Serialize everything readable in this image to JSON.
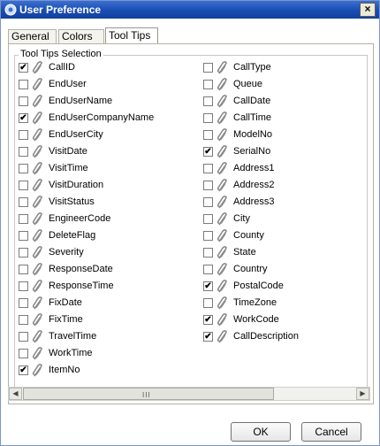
{
  "window": {
    "title": "User Preference",
    "close_glyph": "×"
  },
  "tabs": [
    {
      "label": "General",
      "active": false
    },
    {
      "label": "Colors",
      "active": false
    },
    {
      "label": "Tool Tips",
      "active": true
    }
  ],
  "group": {
    "label": "Tool Tips Selection"
  },
  "items_left": [
    {
      "label": "CallID",
      "checked": true
    },
    {
      "label": "EndUser",
      "checked": false
    },
    {
      "label": "EndUserName",
      "checked": false
    },
    {
      "label": "EndUserCompanyName",
      "checked": true
    },
    {
      "label": "EndUserCity",
      "checked": false
    },
    {
      "label": "VisitDate",
      "checked": false
    },
    {
      "label": "VisitTime",
      "checked": false
    },
    {
      "label": "VisitDuration",
      "checked": false
    },
    {
      "label": "VisitStatus",
      "checked": false
    },
    {
      "label": "EngineerCode",
      "checked": false
    },
    {
      "label": "DeleteFlag",
      "checked": false
    },
    {
      "label": "Severity",
      "checked": false
    },
    {
      "label": "ResponseDate",
      "checked": false
    },
    {
      "label": "ResponseTime",
      "checked": false
    },
    {
      "label": "FixDate",
      "checked": false
    },
    {
      "label": "FixTime",
      "checked": false
    },
    {
      "label": "TravelTime",
      "checked": false
    },
    {
      "label": "WorkTime",
      "checked": false
    },
    {
      "label": "ItemNo",
      "checked": true
    }
  ],
  "items_right": [
    {
      "label": "CallType",
      "checked": false
    },
    {
      "label": "Queue",
      "checked": false
    },
    {
      "label": "CallDate",
      "checked": false
    },
    {
      "label": "CallTime",
      "checked": false
    },
    {
      "label": "ModelNo",
      "checked": false
    },
    {
      "label": "SerialNo",
      "checked": true
    },
    {
      "label": "Address1",
      "checked": false
    },
    {
      "label": "Address2",
      "checked": false
    },
    {
      "label": "Address3",
      "checked": false
    },
    {
      "label": "City",
      "checked": false
    },
    {
      "label": "County",
      "checked": false
    },
    {
      "label": "State",
      "checked": false
    },
    {
      "label": "Country",
      "checked": false
    },
    {
      "label": "PostalCode",
      "checked": true
    },
    {
      "label": "TimeZone",
      "checked": false
    },
    {
      "label": "WorkCode",
      "checked": true
    },
    {
      "label": "CallDescription",
      "checked": true
    }
  ],
  "scrollbar": {
    "left_arrow": "◀",
    "right_arrow": "▶",
    "grip": "III"
  },
  "buttons": {
    "ok": "OK",
    "cancel": "Cancel"
  },
  "check_glyph": "✔",
  "colors": {
    "titlebar": "#1b4fb4",
    "clip": "#8a8a8a"
  },
  "icons": {
    "title": "user-preference-gear-icon",
    "item": "paperclip-icon"
  }
}
